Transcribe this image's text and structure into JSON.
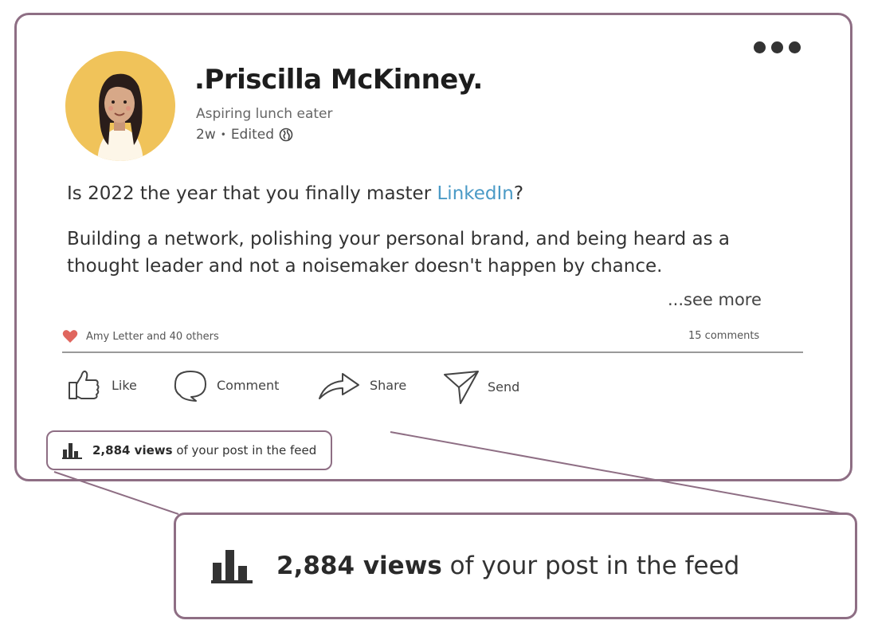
{
  "post": {
    "author_name": ".Priscilla McKinney.",
    "author_tagline": "Aspiring lunch eater",
    "post_age": "2w",
    "edited_label": "Edited",
    "line1_before": "Is 2022 the year that you finally master ",
    "line1_link": "LinkedIn",
    "line1_after": "?",
    "body": "Building a network, polishing your personal brand, and being heard as a thought leader and not a noisemaker doesn't happen by chance.",
    "see_more": "...see more",
    "reactions_text": "Amy Letter and 40 others",
    "comments_text": "15 comments"
  },
  "actions": {
    "like": "Like",
    "comment": "Comment",
    "share": "Share",
    "send": "Send"
  },
  "views": {
    "count": "2,884 views",
    "suffix": " of your post in the feed"
  },
  "colors": {
    "frame": "#8e6e84",
    "link": "#4a9ac6",
    "heart": "#e0665e",
    "avatar_bg": "#f0c35a"
  },
  "icons": [
    "more-options-icon",
    "globe-icon",
    "heart-icon",
    "thumbs-up-icon",
    "comment-bubble-icon",
    "share-arrow-icon",
    "send-plane-icon",
    "bar-chart-icon"
  ]
}
